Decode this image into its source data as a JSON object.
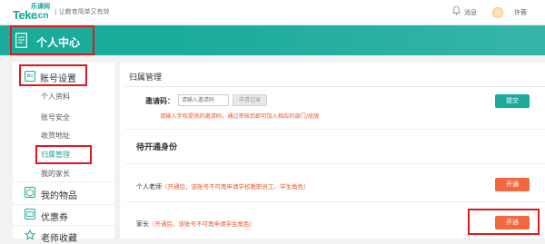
{
  "header": {
    "logo_small": "乐课网",
    "logo_mark": "Teke",
    "logo_domain": ".cn",
    "slogan": "| 让教育简单又有效",
    "notifications_label": "消息",
    "user_name": "许蓉"
  },
  "banner": {
    "title": "个人中心"
  },
  "sidebar": {
    "group_label": "账号设置",
    "sub_items": [
      "个人资料",
      "账号安全",
      "收货地址",
      "归属管理",
      "我的家长"
    ],
    "main_items": [
      "我的物品",
      "优惠券",
      "老师收藏"
    ]
  },
  "main": {
    "section_title": "归属管理",
    "invite": {
      "label": "邀请码：",
      "placeholder": "请输入邀请码",
      "apply_label": "申请记录",
      "submit_label": "提交",
      "hint": "请输入学校提供的邀请码，通过审核后即可加入相应的部门/班级"
    },
    "pending_title": "待开通身份",
    "roles": [
      {
        "name": "个人老师",
        "note": "（开通后，该账号不可再申请学校教职员工、学生角色）",
        "button": "开通"
      },
      {
        "name": "家长",
        "note": "（开通后，该账号不可再申请学生角色）",
        "button": "开通"
      }
    ]
  },
  "colors": {
    "accent": "#1aab9b",
    "highlight": "#e0171e",
    "orange": "#f2683f"
  }
}
